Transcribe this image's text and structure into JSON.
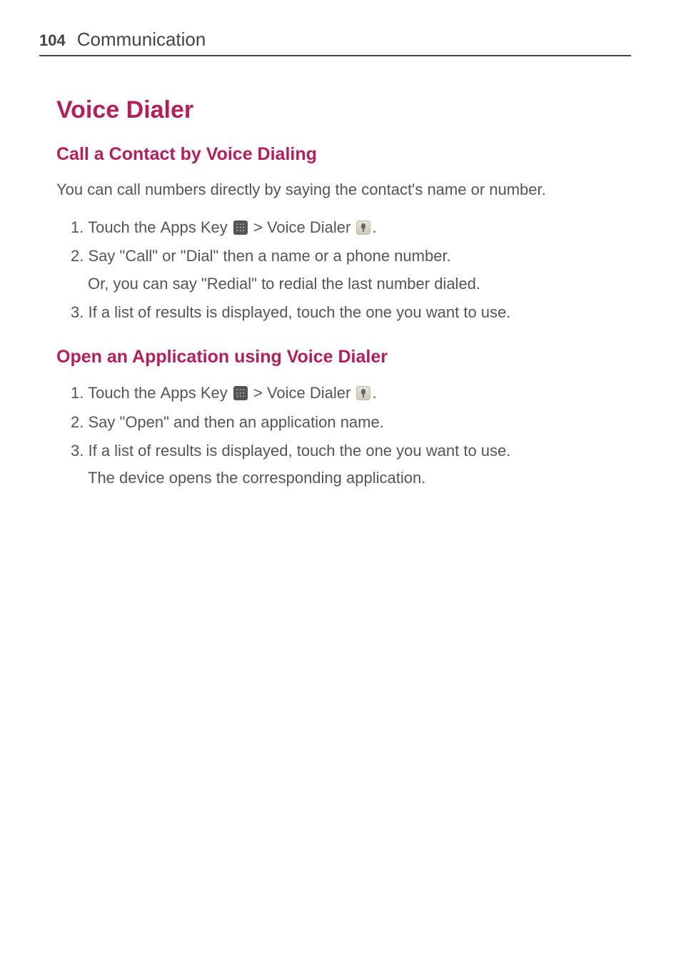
{
  "header": {
    "page_number": "104",
    "chapter": "Communication"
  },
  "title": "Voice Dialer",
  "section1": {
    "heading": "Call a Contact by Voice Dialing",
    "intro": "You can call numbers directly by saying the contact's name or number.",
    "steps": [
      {
        "num": "1.",
        "pre": "Touch the ",
        "bold1": "Apps Key",
        "mid": " > ",
        "bold2": "Voice Dialer",
        "post": "."
      },
      {
        "num": "2.",
        "line": "Say \"Call\" or \"Dial\" then a name or a phone number.",
        "sub": "Or, you can say \"Redial\" to redial the last number dialed."
      },
      {
        "num": "3.",
        "line": "If a list of results is displayed, touch the one you want to use."
      }
    ]
  },
  "section2": {
    "heading": "Open an Application using Voice Dialer",
    "steps": [
      {
        "num": "1.",
        "pre": "Touch the ",
        "bold1": "Apps Key",
        "mid": " > ",
        "bold2": "Voice Dialer",
        "post": "."
      },
      {
        "num": "2.",
        "line": "Say \"Open\" and then an application name."
      },
      {
        "num": "3.",
        "line": "If a list of results is displayed, touch the one you want to use.",
        "sub": "The device opens the corresponding application."
      }
    ]
  }
}
